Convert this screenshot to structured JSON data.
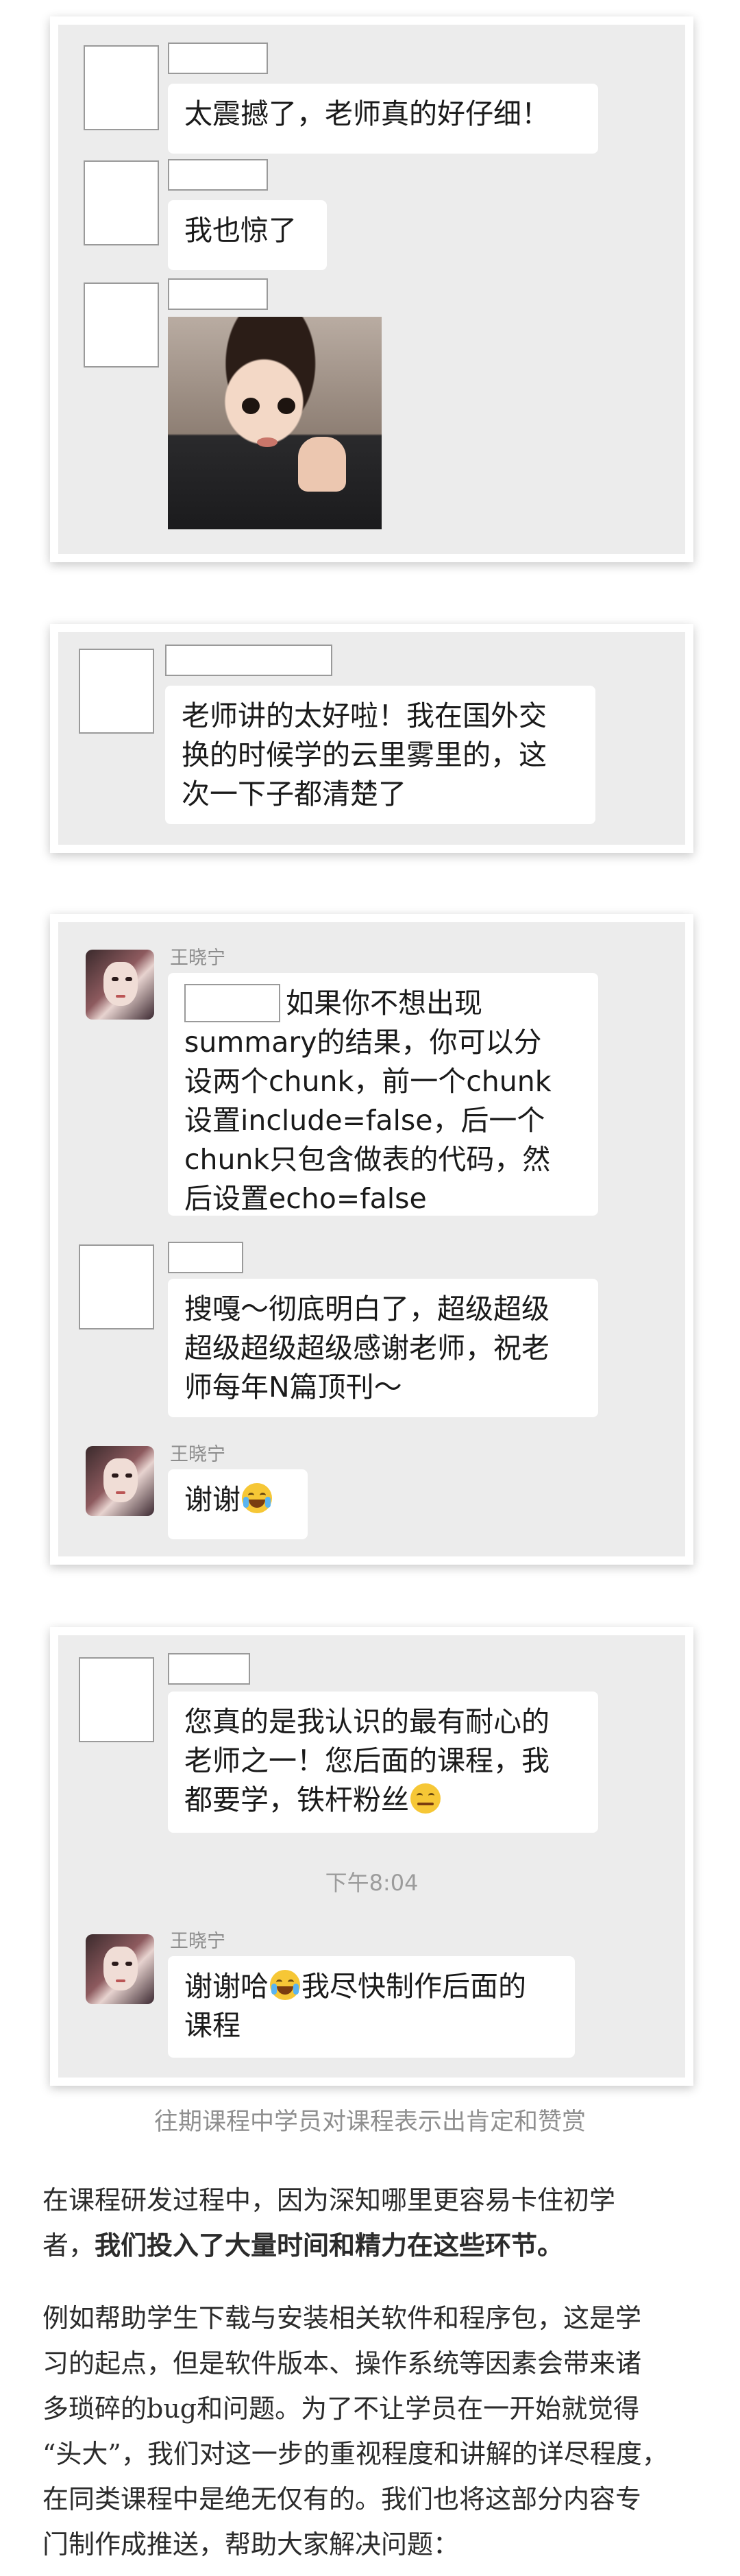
{
  "card1": {
    "msg1": "太震撼了，老师真的好仔细！",
    "msg2": "我也惊了"
  },
  "card2": {
    "msg1_lines": [
      "老师讲的太好啦！我在国外交",
      "换的时候学的云里雾里的，这",
      "次一下子都清楚了"
    ]
  },
  "card3": {
    "teacher_name": "王晓宁",
    "teacher_msg_lines": [
      "如果你不想出现",
      "summary的结果，你可以分",
      "设两个chunk，前一个chunk",
      "设置include=false，后一个",
      "chunk只包含做表的代码，然",
      "后设置echo=false"
    ],
    "student_msg_lines": [
      "搜嘎～彻底明白了，超级超级",
      "超级超级超级感谢老师，祝老",
      "师每年N篇顶刊～"
    ],
    "teacher_reply": "谢谢"
  },
  "card4": {
    "student_msg_lines": [
      "您真的是我认识的最有耐心的",
      "老师之一！您后面的课程，我",
      "都要学，铁杆粉丝"
    ],
    "timestamp": "下午8:04",
    "teacher_name": "王晓宁",
    "teacher_msg_line1_a": "谢谢哈",
    "teacher_msg_line1_b": "我尽快制作后面的",
    "teacher_msg_line2": "课程"
  },
  "caption": "往期课程中学员对课程表示出肯定和赞赏",
  "para1": {
    "line1": "在课程研发过程中，因为深知哪里更容易卡住初学",
    "line2_a": "者，",
    "line2_bold": "我们投入了大量时间和精力在这些环节。"
  },
  "para2_lines": [
    "例如帮助学生下载与安装相关软件和程序包，这是学",
    "习的起点，但是软件版本、操作系统等因素会带来诸",
    "多琐碎的bug和问题。为了不让学员在一开始就觉得",
    "“头大”，我们对这一步的重视程度和讲解的详尽程度，",
    "在同类课程中是绝无仅有的。我们也将这部分内容专",
    "门制作成推送，帮助大家解决问题："
  ],
  "icons": {
    "laugh_cry": "laugh-tears-emoji",
    "sweat": "sweat-smile-emoji"
  }
}
